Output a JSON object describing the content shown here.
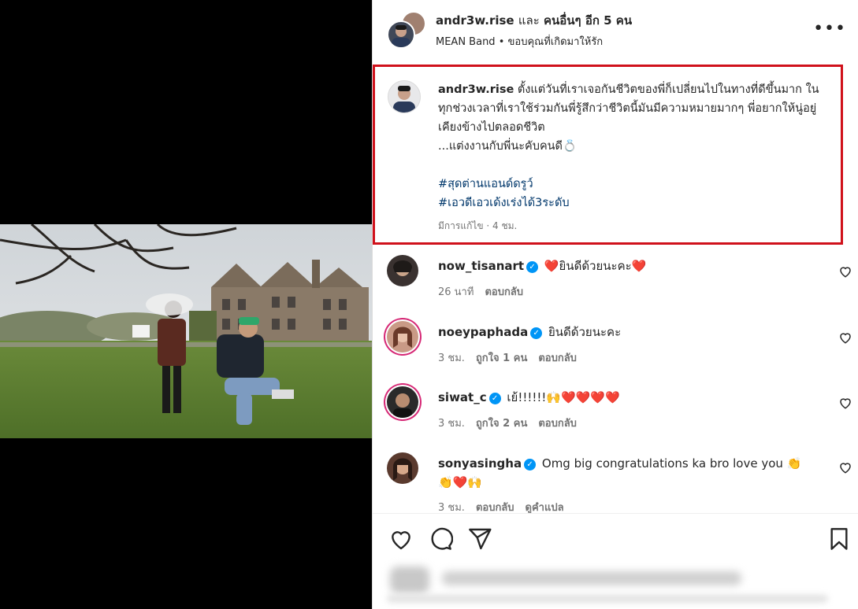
{
  "header": {
    "username": "andr3w.rise",
    "and_text": "และ",
    "others": "คนอื่นๆ อีก 5 คน",
    "sub_left": "MEAN Band",
    "sub_sep": " • ",
    "sub_right": "ขอบคุณที่เกิดมาให้รัก",
    "more_label": "•••"
  },
  "caption": {
    "username": "andr3w.rise",
    "text": "ตั้งแต่วันที่เราเจอกันชีวิตของพี่ก็เปลี่ยนไปในทางที่ดีขึ้นมาก ในทุกช่วงเวลาที่เราใช้ร่วมกันพี่รู้สึกว่าชีวิตนี้มันมีความหมายมากๆ พี่อยากให้นู่อยู่เคียงข้างไปตลอดชีวิต",
    "line2": "...แต่งงานกับพี่นะคับคนดี💍",
    "tags": [
      "#สุดต่านแอนด์ดรูว์",
      "#เอวดีเอวเด้งเร่งได้3ระดับ"
    ],
    "meta": "มีการแก้ไข · 4 ชม."
  },
  "comments": [
    {
      "user": "now_tisanart",
      "text": "❤️ยินดีด้วยนะคะ❤️",
      "time": "26 นาที",
      "likes": "",
      "reply": "ตอบกลับ",
      "translate": ""
    },
    {
      "user": "noeypaphada",
      "text": "ยินดีด้วยนะคะ",
      "time": "3 ชม.",
      "likes": "ถูกใจ 1 คน",
      "reply": "ตอบกลับ",
      "translate": ""
    },
    {
      "user": "siwat_c",
      "text": "เย้!!!!!!🙌❤️❤️❤️❤️",
      "time": "3 ชม.",
      "likes": "ถูกใจ 2 คน",
      "reply": "ตอบกลับ",
      "translate": ""
    },
    {
      "user": "sonyasingha",
      "text": "Omg big congratulations ka bro love you 👏 👏❤️🙌",
      "time": "3 ชม.",
      "likes": "",
      "reply": "ตอบกลับ",
      "translate": "ดูคำแปล"
    }
  ],
  "icons": {
    "like": "heart-icon",
    "comment": "comment-icon",
    "share": "send-icon",
    "save": "bookmark-icon"
  },
  "colors": {
    "highlight_border": "#d0111b",
    "link": "#00376b",
    "verified": "#0095f6"
  }
}
